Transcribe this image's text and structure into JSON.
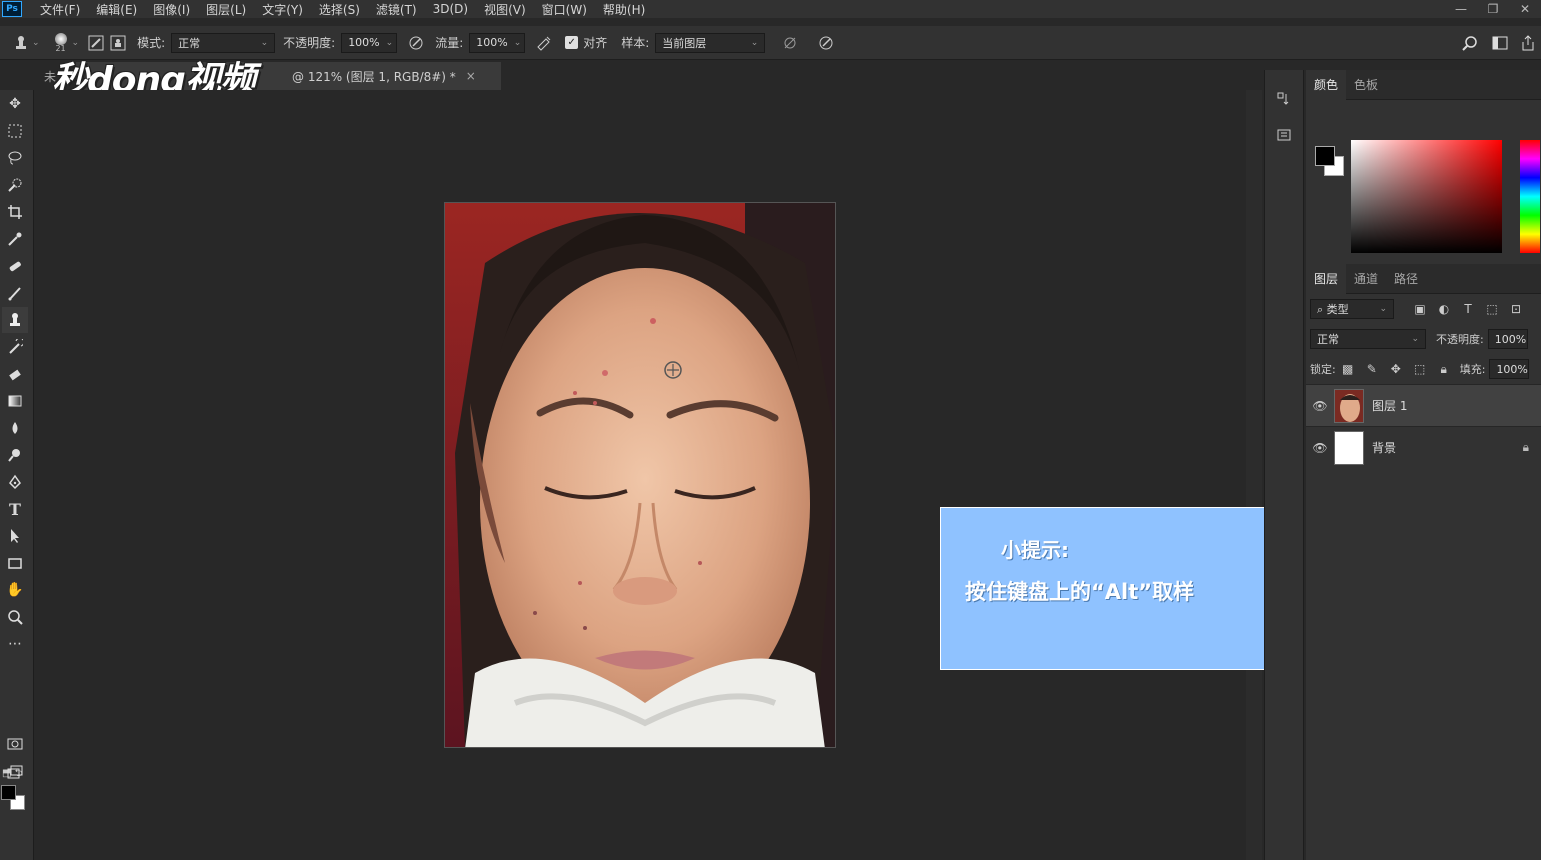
{
  "app": {
    "logo_text": "Ps"
  },
  "menu": [
    "文件(F)",
    "编辑(E)",
    "图像(I)",
    "图层(L)",
    "文字(Y)",
    "选择(S)",
    "滤镜(T)",
    "3D(D)",
    "视图(V)",
    "窗口(W)",
    "帮助(H)"
  ],
  "window_controls": {
    "minimize": "—",
    "restore": "❐",
    "close": "✕"
  },
  "options": {
    "brush_size": "21",
    "mode_label": "模式:",
    "mode_value": "正常",
    "opacity_label": "不透明度:",
    "opacity_value": "100%",
    "flow_label": "流量:",
    "flow_value": "100%",
    "align_label": "对齐",
    "sample_label": "样本:",
    "sample_value": "当前图层"
  },
  "document": {
    "tab_title_visible": "@ 121% (图层 1, RGB/8#) *",
    "tab_prefix": "未",
    "close_symbol": "×"
  },
  "watermark": {
    "text": "秒dong视频"
  },
  "tip": {
    "title": "小提示:",
    "text": "按住键盘上的“Alt”取样"
  },
  "panels": {
    "color_tabs": [
      "颜色",
      "色板"
    ],
    "layer_tabs": [
      "图层",
      "通道",
      "路径"
    ],
    "filter_kind": "类型",
    "blend_mode": "正常",
    "opacity_label": "不透明度:",
    "opacity_value": "100%",
    "lock_label": "锁定:",
    "fill_label": "填充:",
    "fill_value": "100%",
    "layers": [
      {
        "name": "图层 1"
      },
      {
        "name": "背景"
      }
    ]
  },
  "colors": {
    "accent": "#31a8ff",
    "tip_bg": "#8fc2ff",
    "fg_color": "#000000",
    "bg_color": "#ffffff"
  }
}
